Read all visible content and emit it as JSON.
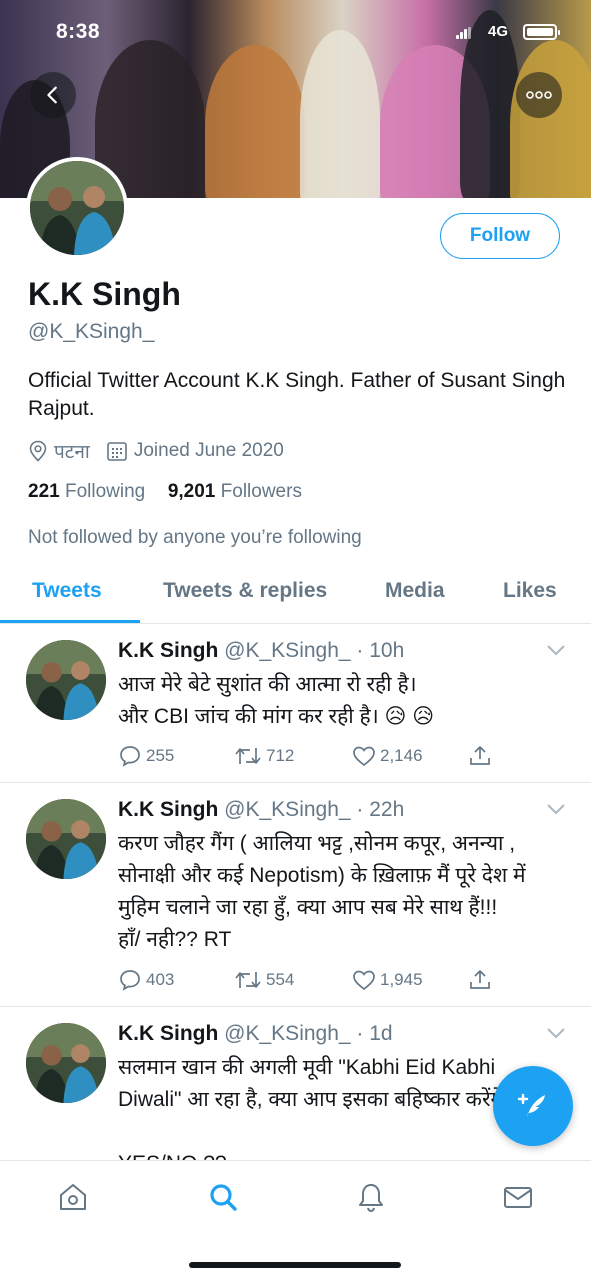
{
  "status_bar": {
    "time": "8:38",
    "network": "4G"
  },
  "header": {
    "back_icon": "chevron-left-icon",
    "more_icon": "more-dots-icon"
  },
  "profile": {
    "follow_label": "Follow",
    "name": "K.K Singh",
    "handle": "@K_KSingh_",
    "bio": "Official Twitter Account K.K Singh. Father of Susant Singh Rajput.",
    "location": "पटना",
    "joined": "Joined June 2020",
    "following_count": "221",
    "following_label": "Following",
    "followers_count": "9,201",
    "followers_label": "Followers",
    "not_followed_text": "Not followed by anyone you’re following"
  },
  "tabs": [
    {
      "label": "Tweets",
      "active": true
    },
    {
      "label": "Tweets & replies",
      "active": false
    },
    {
      "label": "Media",
      "active": false
    },
    {
      "label": "Likes",
      "active": false
    }
  ],
  "tweets": [
    {
      "name": "K.K Singh",
      "meta": "@K_KSingh_ · 10h",
      "text": "आज मेरे बेटे सुशांत की आत्मा रो रही है।\nऔर CBI जांच की मांग कर रही है। 😥 😥",
      "replies": "255",
      "retweets": "712",
      "likes": "2,146"
    },
    {
      "name": "K.K Singh",
      "meta": "@K_KSingh_ · 22h",
      "text": "करण जौहर गैंग ( आलिया भट्ट ,सोनम कपूर, अनन्या , सोनाक्षी  और कई Nepotism) के ख़िलाफ़ मैं पूरे देश में मुहिम चलाने जा रहा हुँ, क्या आप सब मेरे साथ हैं!!!\nहाँ/ नही?? RT",
      "replies": "403",
      "retweets": "554",
      "likes": "1,945"
    },
    {
      "name": "K.K Singh",
      "meta": "@K_KSingh_ · 1d",
      "text": "सलमान खान  की अगली मूवी \"Kabhi Eid Kabhi Diwali\" आ रहा है, क्या आप इसका बहिष्कार करेंगे?\n\nYES/NO ??"
    }
  ],
  "colors": {
    "accent": "#1da1f2",
    "secondary_text": "#657786",
    "border": "#e1e8ed"
  },
  "bottom_nav": [
    "home-icon",
    "search-icon",
    "notifications-bell-icon",
    "messages-envelope-icon"
  ],
  "fab_icon": "compose-tweet-icon"
}
